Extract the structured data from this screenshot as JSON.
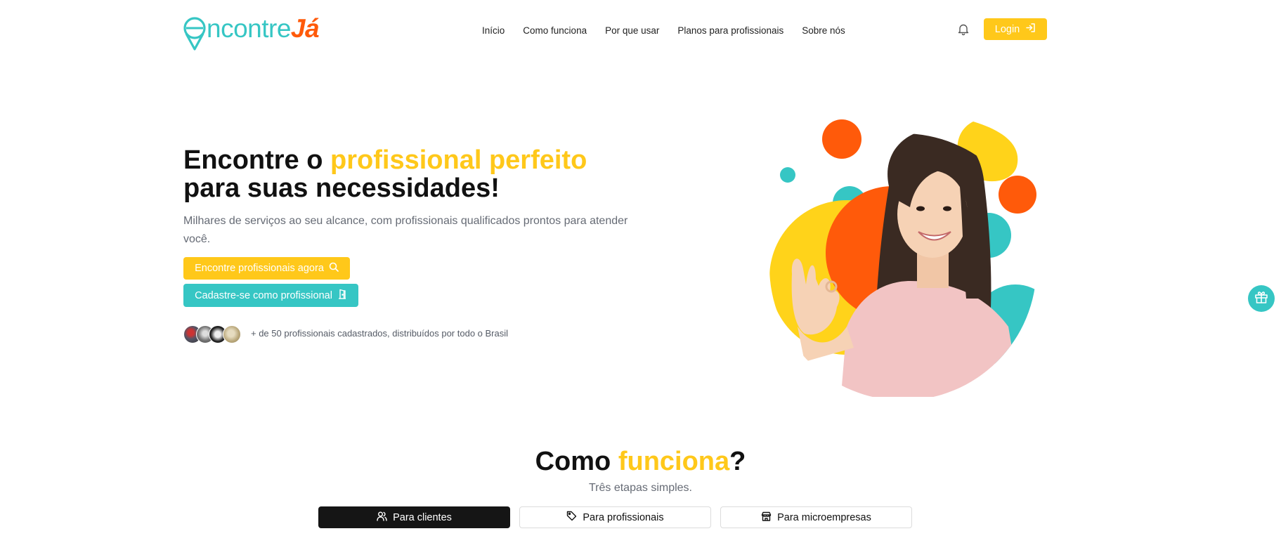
{
  "brand": {
    "name_part1": "ncontre",
    "name_part2": "Já",
    "colors": {
      "teal": "#36c6c4",
      "orange": "#ff5a0a",
      "yellow": "#ffc81a"
    }
  },
  "nav": {
    "items": [
      "Início",
      "Como funciona",
      "Por que usar",
      "Planos para profissionais",
      "Sobre nós"
    ]
  },
  "header": {
    "bell_icon": "bell-icon",
    "login_label": "Login",
    "login_icon": "login-arrow-icon"
  },
  "hero": {
    "title_part1": "Encontre o ",
    "title_highlight": "profissional perfeito",
    "title_part2": "para suas necessidades!",
    "subtitle": "Milhares de serviços ao seu alcance, com profissionais qualificados prontos para atender você.",
    "cta_primary": "Encontre profissionais agora",
    "cta_primary_icon": "search-icon",
    "cta_secondary": "Cadastre-se como profissional",
    "cta_secondary_icon": "door-icon",
    "pros_text": "+ de 50 profissionais cadastrados, distribuídos por todo o Brasil"
  },
  "how": {
    "title_part1": "Como ",
    "title_highlight": "funciona",
    "title_part2": "?",
    "subtitle": "Três etapas simples.",
    "tabs": [
      {
        "label": "Para clientes",
        "icon": "users-icon",
        "active": true
      },
      {
        "label": "Para profissionais",
        "icon": "tag-icon",
        "active": false
      },
      {
        "label": "Para microempresas",
        "icon": "store-icon",
        "active": false
      }
    ]
  },
  "floating": {
    "gift_icon": "gift-icon"
  }
}
